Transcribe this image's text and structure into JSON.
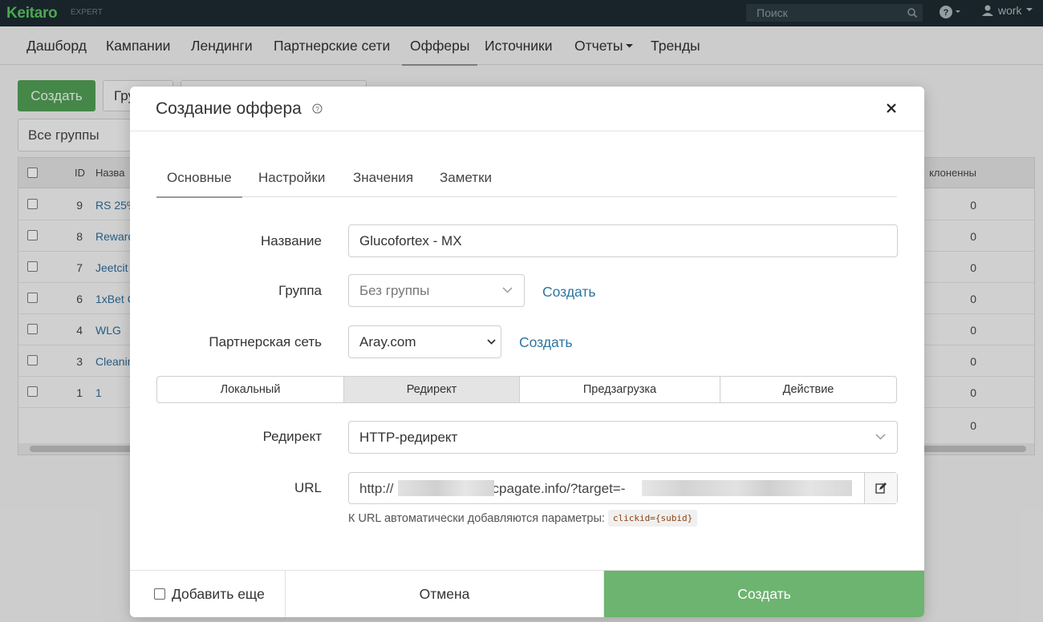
{
  "topbar": {
    "logo": "Keitaro",
    "edition": "EXPERT",
    "search_placeholder": "Поиск",
    "user": "work"
  },
  "nav": {
    "items": [
      "Дашборд",
      "Кампании",
      "Лендинги",
      "Партнерские сети",
      "Офферы",
      "Источники",
      "Отчеты",
      "Тренды"
    ],
    "active": "Офферы"
  },
  "page": {
    "create_label": "Создать",
    "groups_label": "Гру",
    "group_filter": "Все группы",
    "table": {
      "headers": {
        "id": "ID",
        "name": "Назва",
        "rejected": "клоненны"
      },
      "rows": [
        {
          "id": "9",
          "name": "RS 25%",
          "rejected": "0"
        },
        {
          "id": "8",
          "name": "Reward",
          "rejected": "0"
        },
        {
          "id": "7",
          "name": "Jeetcit",
          "rejected": "0"
        },
        {
          "id": "6",
          "name": "1xBet C",
          "rejected": "0"
        },
        {
          "id": "4",
          "name": "WLG",
          "rejected": "0"
        },
        {
          "id": "3",
          "name": "Cleanin",
          "rejected": "0"
        },
        {
          "id": "1",
          "name": "1",
          "rejected": "0"
        }
      ],
      "total_rejected": "0"
    }
  },
  "modal": {
    "title": "Создание оффера",
    "tabs": [
      "Основные",
      "Настройки",
      "Значения",
      "Заметки"
    ],
    "active_tab": "Основные",
    "fields": {
      "name_label": "Название",
      "name_value": "Glucofortex - MX",
      "group_label": "Группа",
      "group_value": "Без группы",
      "group_create": "Создать",
      "network_label": "Партнерская сеть",
      "network_value": "Aray.com",
      "network_create": "Создать",
      "type_options": [
        "Локальный",
        "Редирект",
        "Предзагрузка",
        "Действие"
      ],
      "type_active": "Редирект",
      "redirect_label": "Редирект",
      "redirect_value": "HTTP-редирект",
      "url_label": "URL",
      "url_part1": "http://",
      "url_part2": "cpagate.info/?target=-",
      "url_hint": "К URL автоматически добавляются параметры:",
      "url_hint_code": "clickid={subid}"
    },
    "footer": {
      "add_more": "Добавить еще",
      "cancel": "Отмена",
      "create": "Создать"
    }
  },
  "colors": {
    "accent_green": "#6cb46f",
    "link_blue": "#2d75a0",
    "topbar_bg": "#1c2a30"
  }
}
